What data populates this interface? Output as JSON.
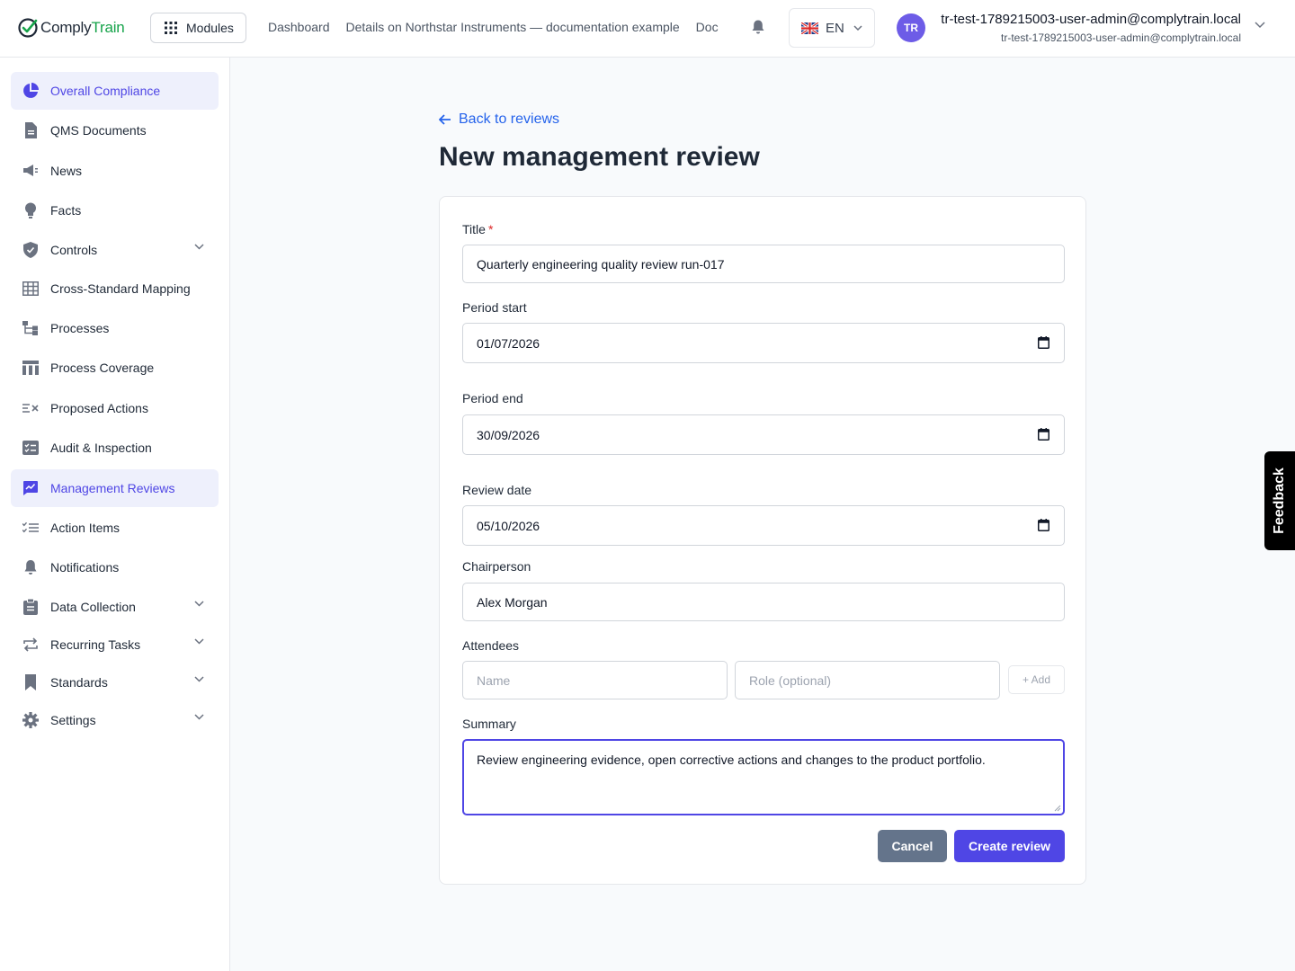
{
  "app": {
    "logo_part1": "Comply",
    "logo_part2": "Train",
    "brand_color": "#16a34a",
    "accent_color": "#4f46e5"
  },
  "header": {
    "modules_label": "Modules",
    "breadcrumbs": [
      "Dashboard",
      "Details on Northstar Instruments — documentation example",
      "Doc"
    ],
    "language": "EN",
    "avatar_initials": "TR",
    "user_name": "tr-test-1789215003-user-admin@complytrain.local",
    "user_email": "tr-test-1789215003-user-admin@complytrain.local"
  },
  "sidebar": {
    "items": [
      {
        "label": "Overall Compliance",
        "icon": "pie-chart-icon",
        "active": true
      },
      {
        "label": "QMS Documents",
        "icon": "document-icon"
      },
      {
        "label": "News",
        "icon": "megaphone-icon"
      },
      {
        "label": "Facts",
        "icon": "lightbulb-icon"
      },
      {
        "label": "Controls",
        "icon": "shield-check-icon",
        "expandable": true
      },
      {
        "label": "Cross-Standard Mapping",
        "icon": "grid-table-icon"
      },
      {
        "label": "Processes",
        "icon": "process-tree-icon"
      },
      {
        "label": "Process Coverage",
        "icon": "columns-table-icon"
      },
      {
        "label": "Proposed Actions",
        "icon": "list-cross-icon"
      },
      {
        "label": "Audit & Inspection",
        "icon": "checklist-box-icon"
      },
      {
        "label": "Management Reviews",
        "icon": "chart-edit-icon",
        "active": true
      },
      {
        "label": "Action Items",
        "icon": "checklist-icon"
      },
      {
        "label": "Notifications",
        "icon": "bell-icon"
      },
      {
        "label": "Data Collection",
        "icon": "clipboard-icon",
        "expandable": true
      },
      {
        "label": "Recurring Tasks",
        "icon": "repeat-icon",
        "expandable": true
      },
      {
        "label": "Standards",
        "icon": "bookmark-icon",
        "expandable": true
      },
      {
        "label": "Settings",
        "icon": "gear-icon",
        "expandable": true
      }
    ]
  },
  "main": {
    "back_label": "Back to reviews",
    "title": "New management review",
    "form": {
      "title_label": "Title",
      "title_value": "Quarterly engineering quality review run-017",
      "period_start_label": "Period start",
      "period_start_value": "01/07/2026",
      "period_end_label": "Period end",
      "period_end_value": "30/09/2026",
      "review_date_label": "Review date",
      "review_date_value": "05/10/2026",
      "chairperson_label": "Chairperson",
      "chairperson_value": "Alex Morgan",
      "attendees_label": "Attendees",
      "attendee_name_placeholder": "Name",
      "attendee_role_placeholder": "Role (optional)",
      "add_label": "+ Add",
      "summary_label": "Summary",
      "summary_value": "Review engineering evidence, open corrective actions and changes to the product portfolio.",
      "cancel_label": "Cancel",
      "create_label": "Create review"
    }
  },
  "feedback_label": "Feedback"
}
